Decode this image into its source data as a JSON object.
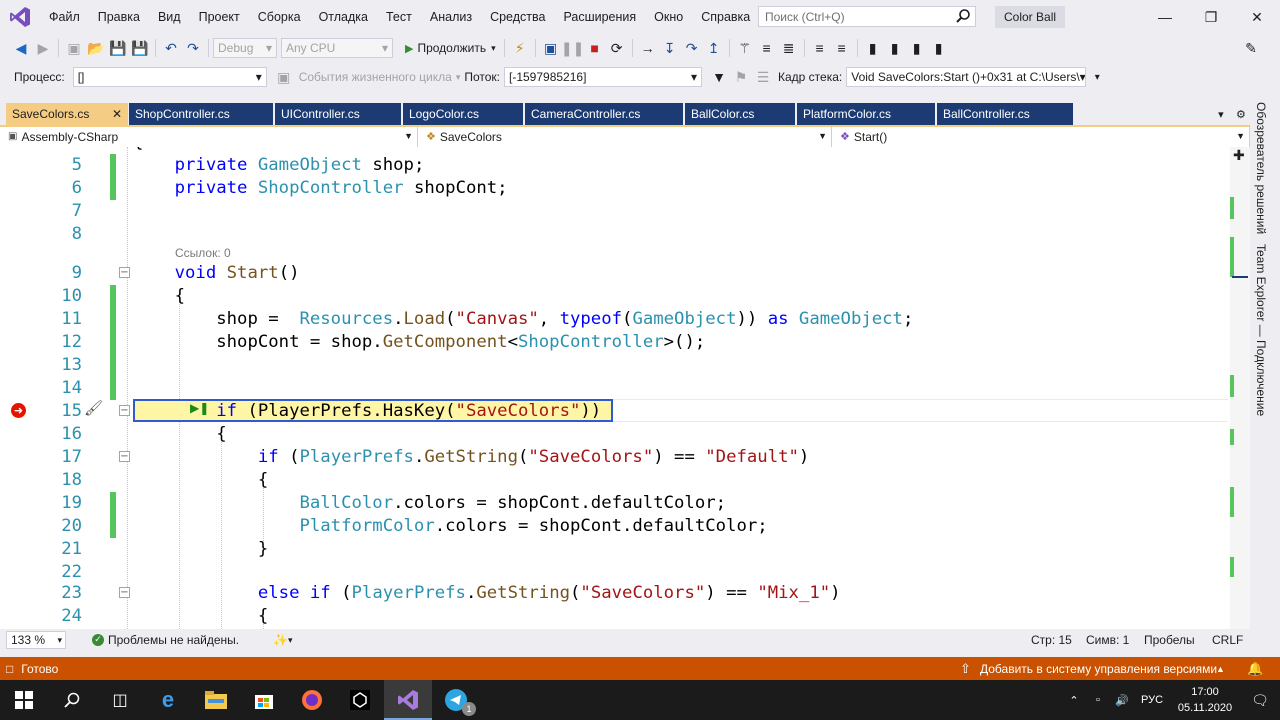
{
  "menubar": {
    "items": [
      "Файл",
      "Правка",
      "Вид",
      "Проект",
      "Сборка",
      "Отладка",
      "Тест",
      "Анализ",
      "Средства",
      "Расширения",
      "Окно",
      "Справка"
    ],
    "search_placeholder": "Поиск (Ctrl+Q)",
    "project_title": "Color Ball"
  },
  "toolbar": {
    "config": "Debug",
    "platform": "Any CPU",
    "continue_label": "Продолжить",
    "process_label": "Процесс:",
    "process_value": "[]",
    "lifecycle_label": "События жизненного цикла",
    "thread_label": "Поток:",
    "thread_value": "[-1597985216]",
    "stack_label": "Кадр стека:",
    "stack_value": "Void SaveColors:Start ()+0x31 at C:\\Users\\"
  },
  "tabs": [
    {
      "label": "SaveColors.cs",
      "active": true
    },
    {
      "label": "ShopController.cs",
      "active": false
    },
    {
      "label": "UIController.cs",
      "active": false
    },
    {
      "label": "LogoColor.cs",
      "active": false
    },
    {
      "label": "CameraController.cs",
      "active": false
    },
    {
      "label": "BallColor.cs",
      "active": false
    },
    {
      "label": "PlatformColor.cs",
      "active": false
    },
    {
      "label": "BallController.cs",
      "active": false
    }
  ],
  "navbar": {
    "project": "Assembly-CSharp",
    "class": "SaveColors",
    "member": "Start()"
  },
  "editor": {
    "ref_hint": "Ссылок: 0",
    "line_numbers": [
      "5",
      "6",
      "7",
      "8",
      "9",
      "10",
      "11",
      "12",
      "13",
      "14",
      "15",
      "16",
      "17",
      "18",
      "19",
      "20",
      "21",
      "22",
      "23",
      "24"
    ]
  },
  "statusline": {
    "zoom": "133 %",
    "problems": "Проблемы не найдены.",
    "row": "Стр: 15",
    "col": "Симв: 1",
    "spaces": "Пробелы",
    "eol": "CRLF"
  },
  "sidetabs": {
    "solution_explorer": "Обозреватель решений",
    "team_explorer": "Team Explorer — Подключение"
  },
  "vsstatus": {
    "ready": "Готово",
    "vcs": "Добавить в систему управления версиями"
  },
  "taskbar": {
    "lang": "РУС",
    "time": "17:00",
    "date": "05.11.2020",
    "notify_count": "1"
  },
  "colors": {
    "accent_tab": "#f5cc84",
    "inactive_tab": "#1c3b73",
    "status_bar": "#ca5100",
    "keyword": "#0000ff",
    "type": "#2b91af",
    "string": "#a31515"
  }
}
